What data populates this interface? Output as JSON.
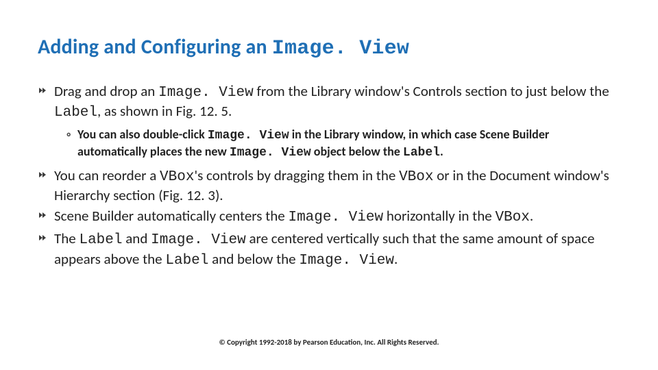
{
  "title_plain": "Adding and Configuring an ",
  "title_code": "Image. View",
  "bullets": [
    {
      "parts": [
        {
          "t": "Drag and drop an "
        },
        {
          "t": "Image. View",
          "code": true
        },
        {
          "t": " from the Library window's Controls section to just below the "
        },
        {
          "t": "Label",
          "code": true
        },
        {
          "t": ", as shown in Fig. 12. 5."
        }
      ],
      "sub": [
        {
          "parts": [
            {
              "t": "You can also double-click "
            },
            {
              "t": "Image. View",
              "code": true
            },
            {
              "t": " in the Library window, in which case Scene Builder automatically places the new "
            },
            {
              "t": "Image. View",
              "code": true
            },
            {
              "t": " object below the "
            },
            {
              "t": "Label",
              "code": true
            },
            {
              "t": "."
            }
          ]
        }
      ]
    },
    {
      "parts": [
        {
          "t": "You can reorder a "
        },
        {
          "t": "VBox",
          "code": true
        },
        {
          "t": "'s controls by dragging them in the "
        },
        {
          "t": "VBox",
          "code": true
        },
        {
          "t": " or in the Document window's Hierarchy section (Fig. 12. 3)."
        }
      ]
    },
    {
      "parts": [
        {
          "t": "Scene Builder automatically centers the "
        },
        {
          "t": "Image. View",
          "code": true
        },
        {
          "t": " horizontally in the "
        },
        {
          "t": "VBox",
          "code": true
        },
        {
          "t": "."
        }
      ]
    },
    {
      "parts": [
        {
          "t": "The "
        },
        {
          "t": "Label",
          "code": true
        },
        {
          "t": " and "
        },
        {
          "t": "Image. View",
          "code": true
        },
        {
          "t": " are centered vertically such that the same amount of space appears above the "
        },
        {
          "t": "Label",
          "code": true
        },
        {
          "t": " and below the "
        },
        {
          "t": "Image. View",
          "code": true
        },
        {
          "t": "."
        }
      ]
    }
  ],
  "footer": "© Copyright 1992-2018 by Pearson Education, Inc. All Rights Reserved."
}
